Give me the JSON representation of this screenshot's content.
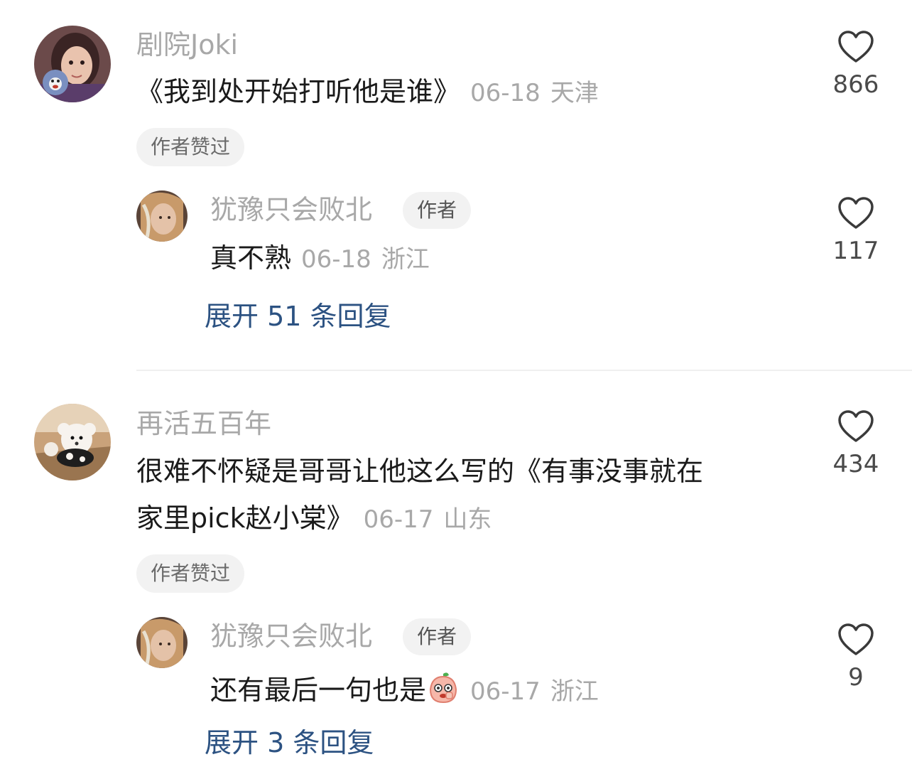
{
  "threads": [
    {
      "comment": {
        "username": "剧院Joki",
        "text": "《我到处开始打听他是谁》",
        "date": "06-18",
        "location": "天津",
        "likes": "866",
        "badge": "作者赞过"
      },
      "reply": {
        "username": "犹豫只会败北",
        "tag": "作者",
        "text": "真不熟",
        "date": "06-18",
        "location": "浙江",
        "likes": "117"
      },
      "expand_label": "展开 51 条回复"
    },
    {
      "comment": {
        "username": "再活五百年",
        "text_line1": "很难不怀疑是哥哥让他这么写的《有事没事就在",
        "text_line2": "家里pick赵小棠》",
        "date": "06-17",
        "location": "山东",
        "likes": "434",
        "badge": "作者赞过"
      },
      "reply": {
        "username": "犹豫只会败北",
        "tag": "作者",
        "text": "还有最后一句也是",
        "emoji": "peach-face-emoji",
        "date": "06-17",
        "location": "浙江",
        "likes": "9"
      },
      "expand_label": "展开 3 条回复"
    }
  ],
  "colors": {
    "username": "#a8a8a8",
    "expand_link": "#2c5282",
    "badge_bg": "#f2f2f2"
  },
  "icons": [
    "heart-outline-icon",
    "avatar-image"
  ]
}
